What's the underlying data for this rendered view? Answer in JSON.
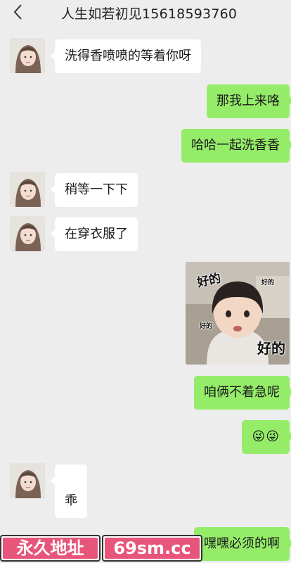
{
  "header": {
    "title": "人生如若初见15618593760",
    "back_icon": "chevron-left-icon"
  },
  "messages": [
    {
      "side": "left",
      "text": "洗得香喷喷的等着你呀"
    },
    {
      "side": "right",
      "text": "那我上来咯"
    },
    {
      "side": "right",
      "text": "哈哈一起洗香香"
    },
    {
      "side": "left",
      "text": "稍等一下下"
    },
    {
      "side": "left",
      "text": "在穿衣服了"
    },
    {
      "side": "right",
      "type": "sticker",
      "caption_top": "好的",
      "caption_bottom": "好的",
      "caption_small_1": "好的",
      "caption_small_2": "好的"
    },
    {
      "side": "right",
      "text": "咱俩不着急呢"
    },
    {
      "side": "right",
      "text": "😜😜"
    },
    {
      "side": "left",
      "text": "乖"
    },
    {
      "side": "right",
      "text": "嘿嘿必须的啊"
    }
  ],
  "watermark": {
    "button1": "永久地址",
    "button2": "69sm.cc"
  },
  "colors": {
    "background": "#ededed",
    "bubble_right": "#95ec69",
    "bubble_left": "#ffffff",
    "watermark_pink": "#e8557a"
  }
}
